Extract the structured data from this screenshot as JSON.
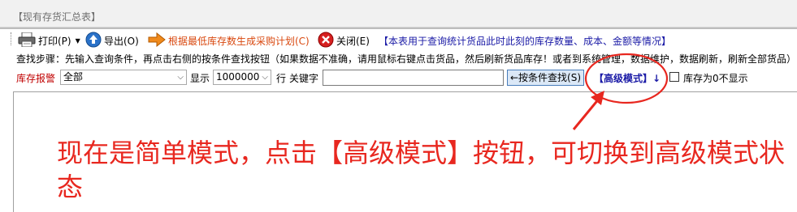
{
  "window": {
    "title": "【现有存货汇总表】"
  },
  "toolbar": {
    "print_label": "打印(P)",
    "export_label": "导出(O)",
    "purchase_plan_label": "根据最低库存数生成采购计划(C)",
    "close_label": "关闭(E)",
    "description": "【本表用于查询统计货品此时此刻的库存数量、成本、金额等情况】"
  },
  "steps_text": "查找步骤：先输入查询条件，再点击右侧的按条件查找按钮（如果数据不准确，请用鼠标右键点击货品，然后刷新货品库存！或者到系统管理，数据维护，数据刷新，刷新全部货品）",
  "filter": {
    "stock_alert_label": "库存报警",
    "stock_alert_value": "全部",
    "show_label": "显示",
    "show_value": "1000000",
    "rows_label": "行",
    "keyword_label": "关键字",
    "keyword_value": "",
    "find_button_label": "←按条件查找(S)",
    "advanced_mode_label": "【高级模式】↓",
    "hide_zero_label": "库存为0不显示",
    "hide_zero_checked": false
  },
  "annotation": {
    "text": "现在是简单模式，点击【高级模式】按钮，可切换到高级模式状态",
    "color": "#e8271f"
  },
  "colors": {
    "accent_red": "#e8271f",
    "link_blue": "#1a1aa6",
    "orange": "#d9480f"
  }
}
